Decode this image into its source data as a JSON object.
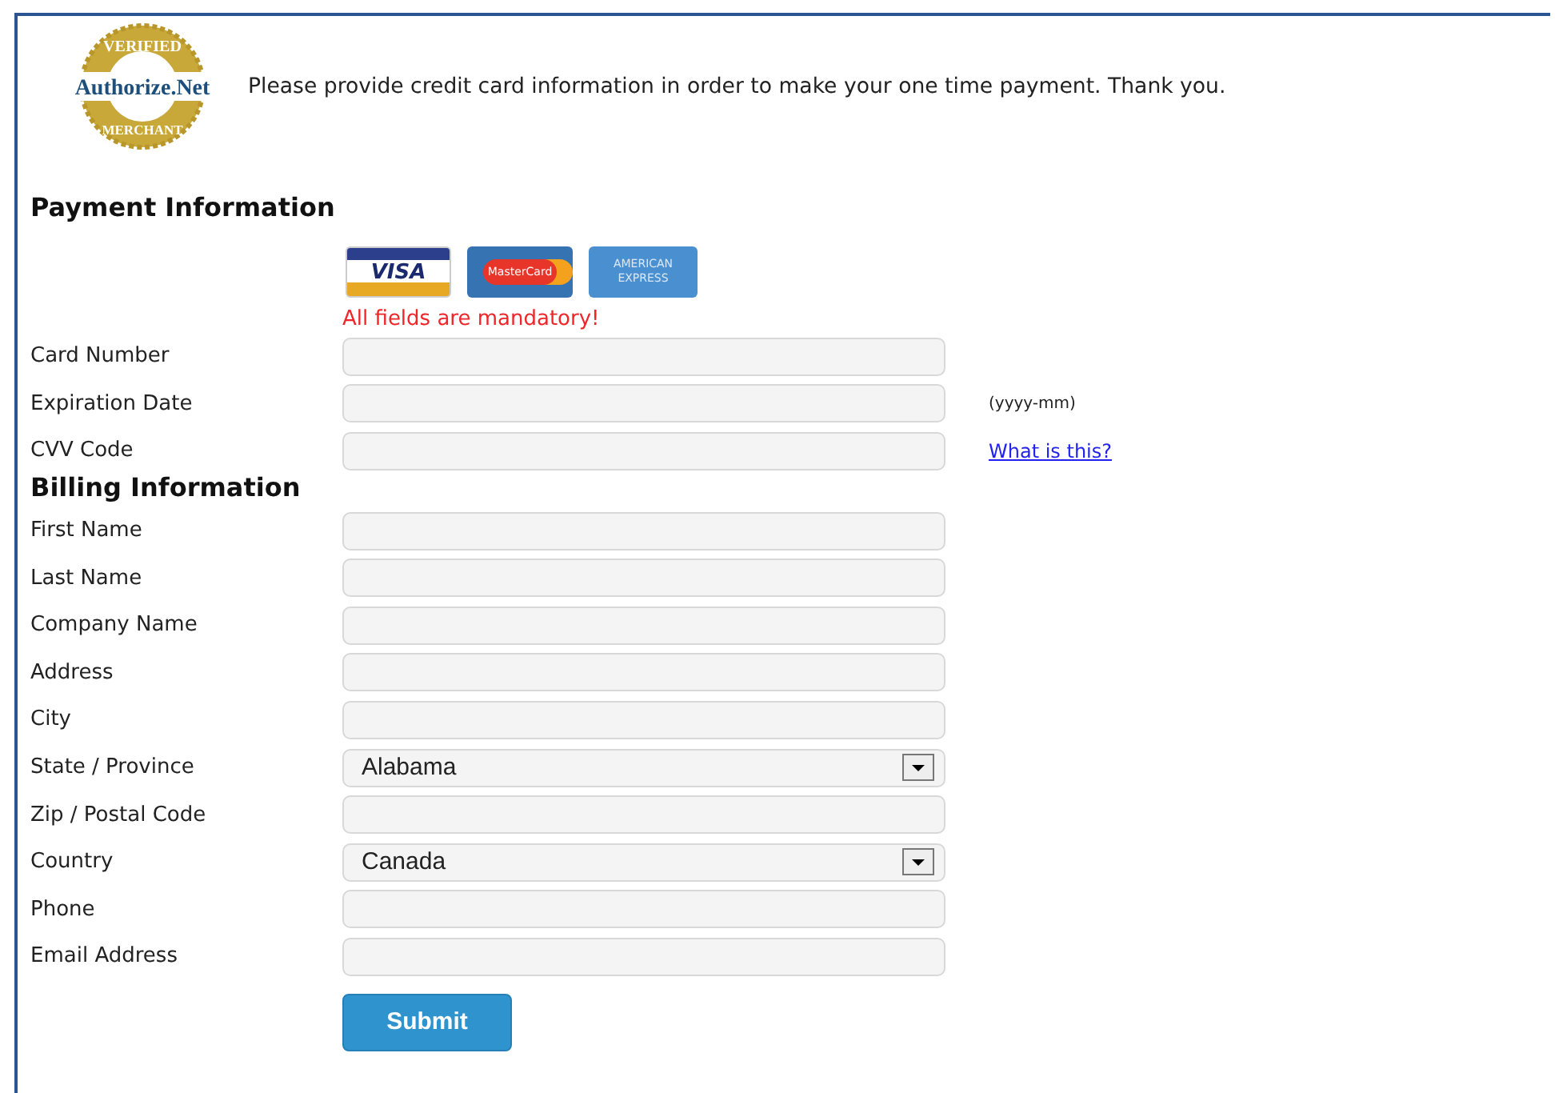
{
  "header": {
    "seal": {
      "top": "VERIFIED",
      "name": "Authorize.Net",
      "bottom": "MERCHANT"
    },
    "message": "Please provide credit card information in order to make your one time payment. Thank you."
  },
  "sections": [
    {
      "heading": "Payment Information",
      "cards": [
        "VISA",
        "MasterCard",
        "AMERICAN EXPRESS"
      ],
      "notice": "All fields are mandatory!",
      "fields": [
        {
          "label": "Card Number",
          "kind": "text"
        },
        {
          "label": "Expiration Date",
          "kind": "text",
          "hint": "(yyyy-mm)"
        },
        {
          "label": "CVV Code",
          "kind": "text",
          "link": "What is this?"
        }
      ]
    },
    {
      "heading": "Billing Information",
      "fields": [
        {
          "label": "First Name",
          "kind": "text"
        },
        {
          "label": "Last Name",
          "kind": "text"
        },
        {
          "label": "Company Name",
          "kind": "text"
        },
        {
          "label": "Address",
          "kind": "text"
        },
        {
          "label": "City",
          "kind": "text"
        },
        {
          "label": "State / Province",
          "kind": "select",
          "value": "Alabama"
        },
        {
          "label": "Zip / Postal Code",
          "kind": "text"
        },
        {
          "label": "Country",
          "kind": "select",
          "value": "Canada"
        },
        {
          "label": "Phone",
          "kind": "text"
        },
        {
          "label": "Email Address",
          "kind": "text"
        }
      ]
    }
  ],
  "submit": "Submit"
}
